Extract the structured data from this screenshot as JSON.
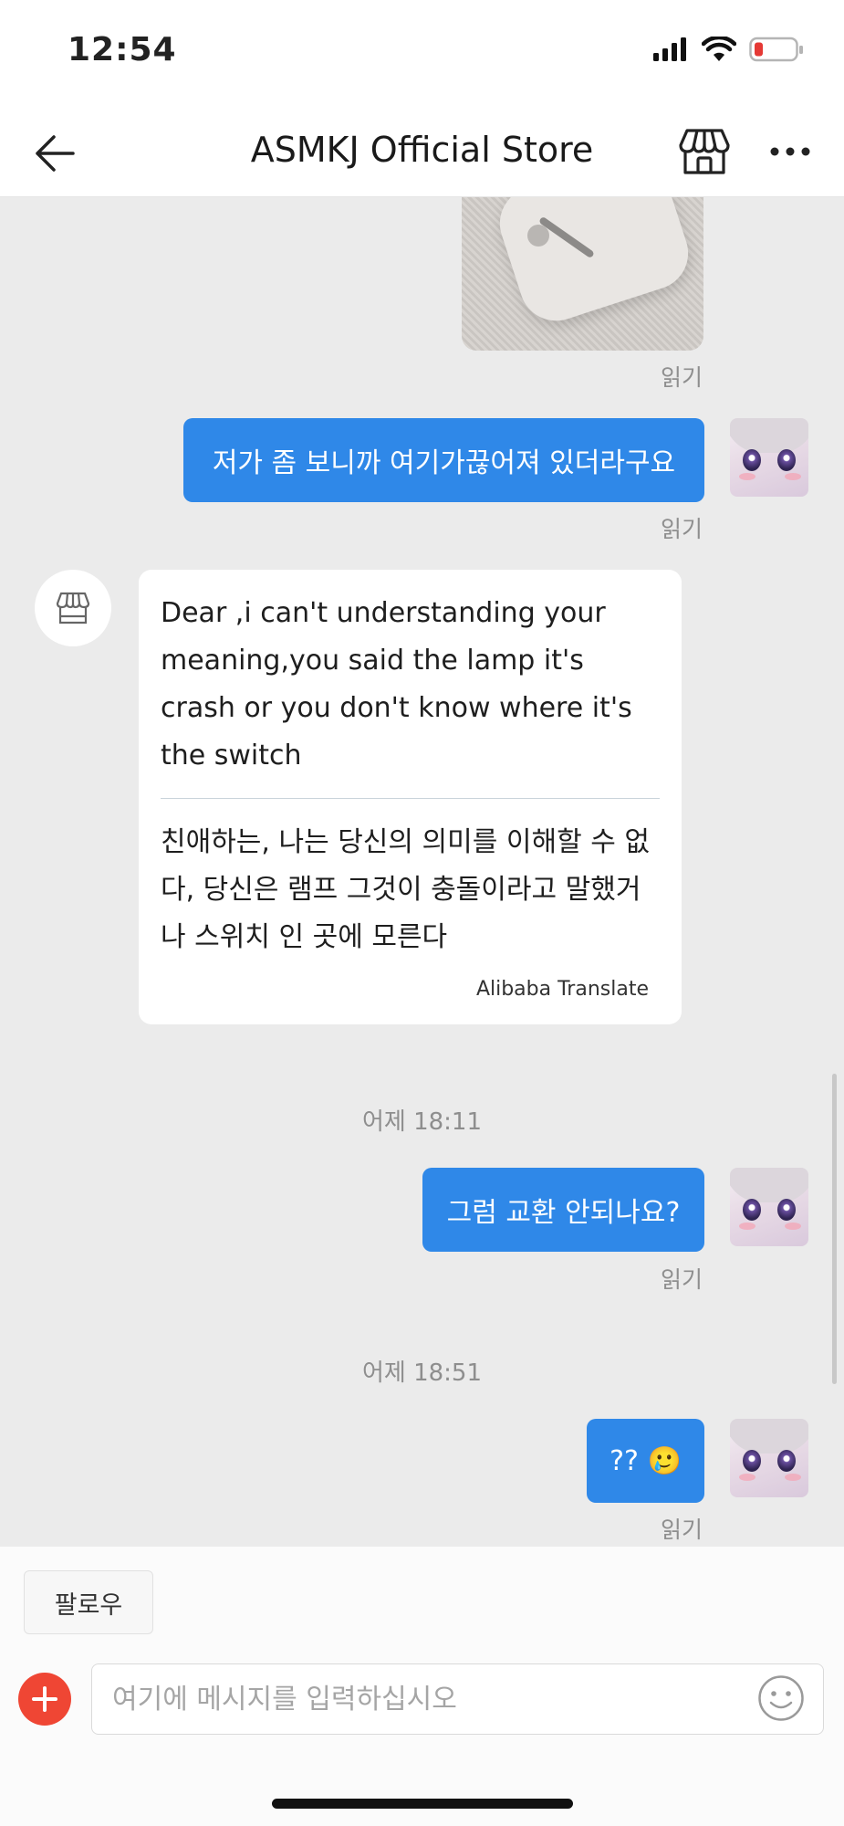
{
  "status_bar": {
    "time": "12:54"
  },
  "header": {
    "title": "ASMKJ Official Store"
  },
  "messages": {
    "read_label": "읽기",
    "out1": "저가 좀 보니까 여기가끊어져 있더라구요",
    "in1": {
      "original": "Dear ,i can't understanding your meaning,you said the lamp it's crash or you don't know where it's the switch",
      "translated": "친애하는, 나는 당신의 의미를 이해할 수 없다, 당신은 램프 그것이 충돌이라고 말했거나 스위치 인 곳에 모른다",
      "translator": "Alibaba Translate"
    },
    "time1": "어제 18:11",
    "out2": "그럼 교환 안되나요?",
    "time2": "어제 18:51",
    "out3": "?? 🥲"
  },
  "bottom": {
    "follow_label": "팔로우",
    "input_placeholder": "여기에 메시지를 입력하십시오"
  },
  "colors": {
    "accent": "#2f88e8",
    "add": "#ef4634",
    "chat_bg": "#ebebeb"
  }
}
